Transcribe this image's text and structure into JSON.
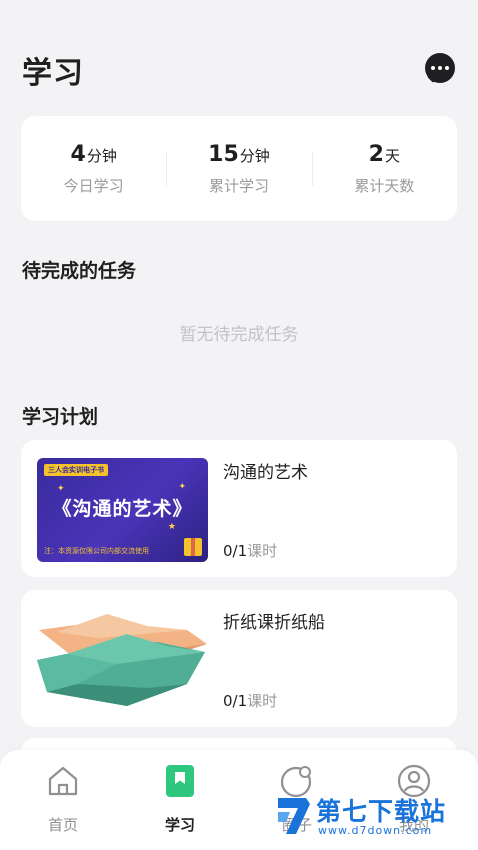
{
  "header": {
    "title": "学习",
    "message_icon": "chat-bubble-icon"
  },
  "stats": [
    {
      "value": "4",
      "unit": "分钟",
      "label": "今日学习"
    },
    {
      "value": "15",
      "unit": "分钟",
      "label": "累计学习"
    },
    {
      "value": "2",
      "unit": "天",
      "label": "累计天数"
    }
  ],
  "tasks": {
    "title": "待完成的任务",
    "empty_text": "暂无待完成任务"
  },
  "plan": {
    "title": "学习计划",
    "courses": [
      {
        "name": "沟通的艺术",
        "progress": "0/1",
        "progress_unit": "课时",
        "thumb": {
          "tag": "三人会实训电子书",
          "title": "《沟通的艺术》",
          "footer": "注：本资源仅限公司内部交流使用"
        }
      },
      {
        "name": "折纸课折纸船",
        "progress": "0/1",
        "progress_unit": "课时"
      }
    ]
  },
  "tabbar": {
    "items": [
      {
        "label": "首页",
        "icon": "home-icon"
      },
      {
        "label": "学习",
        "icon": "bookmark-icon",
        "active": true
      },
      {
        "label": "圈子",
        "icon": "planet-icon"
      },
      {
        "label": "我的",
        "icon": "user-icon"
      }
    ]
  },
  "watermark": {
    "name": "第七下载站",
    "url": "www.d7down.com"
  },
  "colors": {
    "accent_green": "#2fc77d",
    "background": "#f3f3f5",
    "card": "#ffffff",
    "muted_text": "#9a9a9f"
  }
}
